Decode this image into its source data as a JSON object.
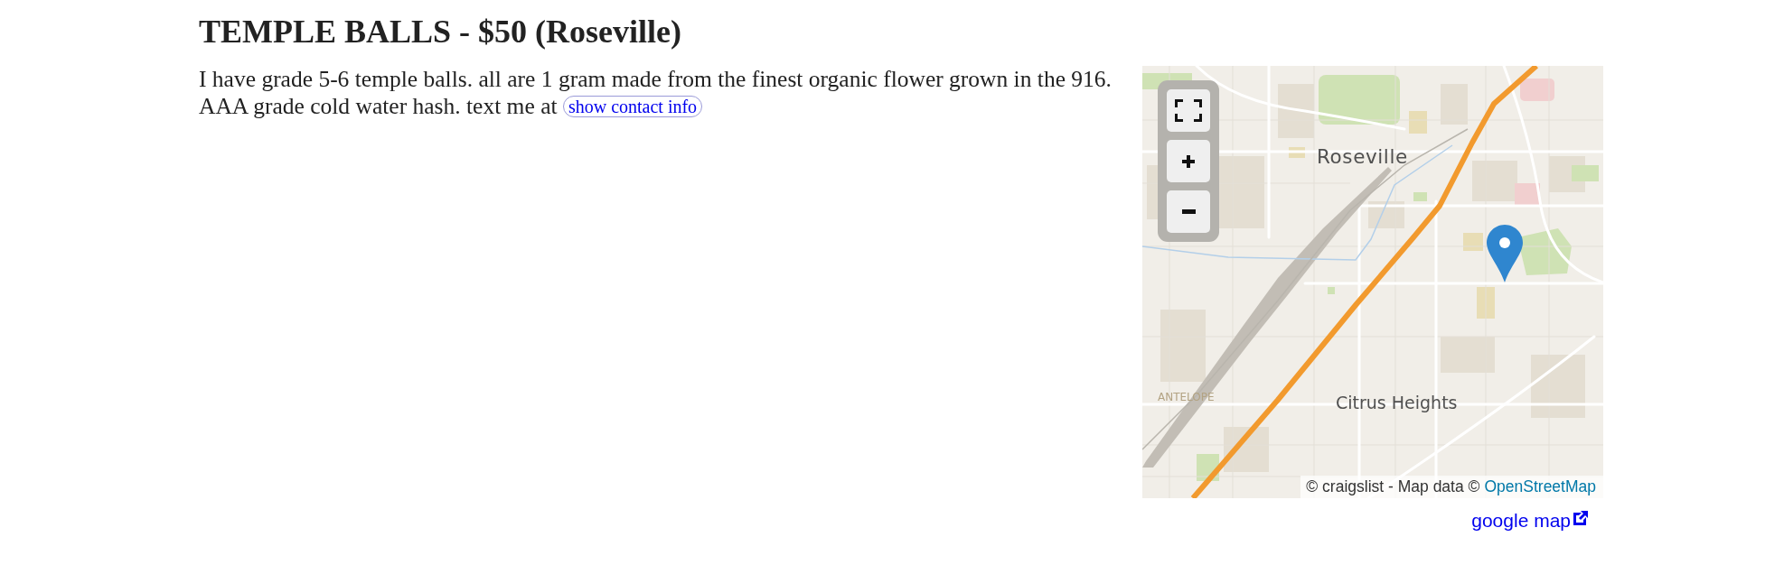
{
  "listing": {
    "title": "TEMPLE BALLS - $50 (Roseville)",
    "body": "I have grade 5-6 temple balls. all are 1 gram made from the finest organic flower grown in the 916. AAA grade cold water hash. text me at",
    "contact_button": "show contact info"
  },
  "map": {
    "controls": [
      {
        "kind": "fullscreen"
      },
      {
        "kind": "zoom_in"
      },
      {
        "kind": "zoom_out"
      }
    ],
    "place_labels": [
      {
        "text": "Roseville",
        "kind": "city"
      },
      {
        "text": "ANTELOPE",
        "kind": "locality"
      },
      {
        "text": "Citrus Heights",
        "kind": "city"
      }
    ],
    "attribution": {
      "text": "© craigslist - Map data ©",
      "link": "OpenStreetMap"
    },
    "google_map_link": "google map"
  }
}
